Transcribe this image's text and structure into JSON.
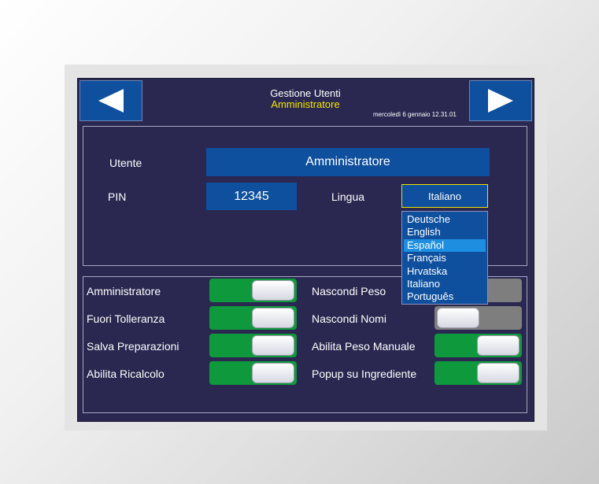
{
  "header": {
    "title": "Gestione Utenti",
    "subtitle": "Amministratore",
    "datetime": "mercoledì 6 gennaio 12.31.01",
    "back_icon": "triangle-left-icon",
    "forward_icon": "triangle-right-icon"
  },
  "user": {
    "user_label": "Utente",
    "user_value": "Amministratore",
    "pin_label": "PIN",
    "pin_value": "12345",
    "language_label": "Lingua",
    "language_value": "Italiano"
  },
  "language_options": [
    "Deutsche",
    "English",
    "Español",
    "Français",
    "Hrvatska",
    "Italiano",
    "Português"
  ],
  "language_highlighted": "Español",
  "permissions_left": [
    {
      "label": "Amministratore",
      "on": true
    },
    {
      "label": "Fuori Tolleranza",
      "on": true
    },
    {
      "label": "Salva Preparazioni",
      "on": true
    },
    {
      "label": "Abilita Ricalcolo",
      "on": true
    }
  ],
  "permissions_right": [
    {
      "label": "Nascondi Peso",
      "on": false
    },
    {
      "label": "Nascondi Nomi",
      "on": false
    },
    {
      "label": "Abilita Peso Manuale",
      "on": true
    },
    {
      "label": "Popup su Ingrediente",
      "on": true
    }
  ],
  "colors": {
    "screen_bg": "#2a2850",
    "button_blue": "#0e4f9e",
    "toggle_on": "#0e9a3c",
    "toggle_off": "#7e7e7e",
    "accent_yellow": "#f2e600",
    "highlight": "#1e8ee0"
  }
}
